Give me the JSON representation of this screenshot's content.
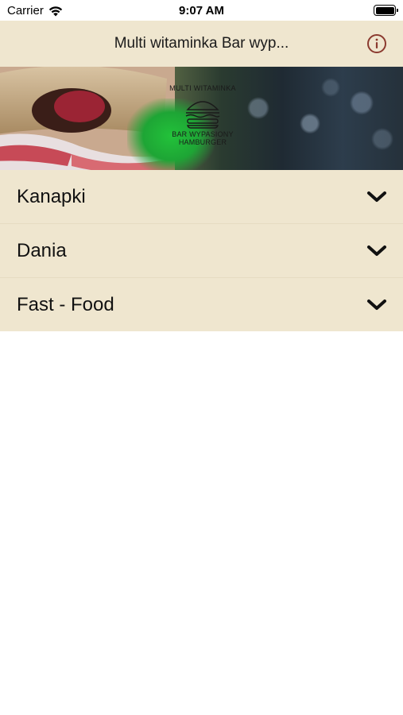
{
  "status_bar": {
    "carrier": "Carrier",
    "time": "9:07 AM"
  },
  "nav": {
    "title": "Multi witaminka Bar wyp...",
    "info_icon": "info-circle-icon",
    "accent_color": "#8b3a2f"
  },
  "banner": {
    "logo_top": "MULTI WITAMINKA",
    "logo_bottom_line1": "BAR WYPASIONY",
    "logo_bottom_line2": "HAMBURGER",
    "logo_icon": "burger-icon"
  },
  "menu": {
    "items": [
      {
        "label": "Kanapki",
        "icon": "chevron-down-icon"
      },
      {
        "label": "Dania",
        "icon": "chevron-down-icon"
      },
      {
        "label": "Fast - Food",
        "icon": "chevron-down-icon"
      }
    ]
  },
  "colors": {
    "nav_background": "#efe6cf",
    "list_background": "#efe6cf",
    "page_background": "#ffffff"
  }
}
